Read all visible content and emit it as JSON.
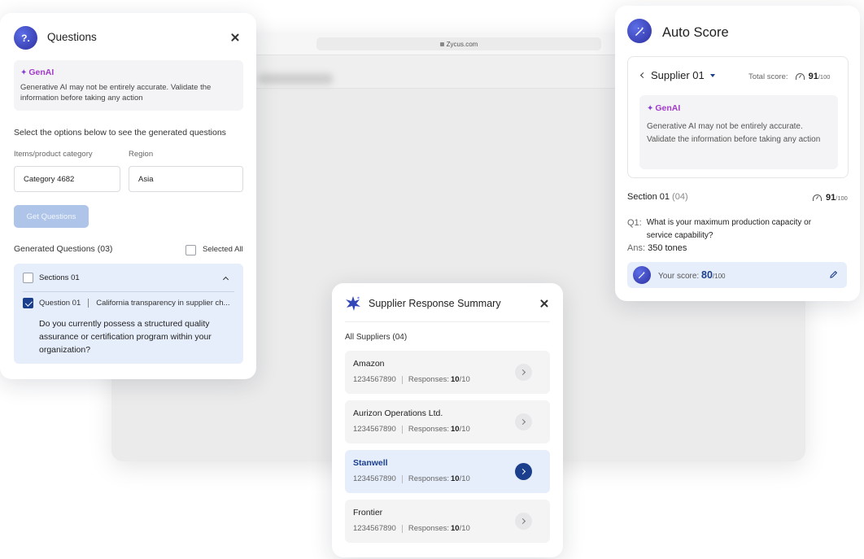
{
  "browser": {
    "url": "Zycus.com"
  },
  "questions_panel": {
    "badge": "?.",
    "title": "Questions",
    "genai": {
      "label": "GenAI",
      "disclaimer": "Generative AI may not be entirely accurate. Validate the information before taking any action"
    },
    "select_hint": "Select the options below to see the generated questions",
    "category_label": "Items/product category",
    "category_value": "Category 4682",
    "region_label": "Region",
    "region_value": "Asia",
    "get_button": "Get Questions",
    "generated_title": "Generated Questions (03)",
    "select_all": "Selected All",
    "section": {
      "title": "Sections 01",
      "question_number": "Question 01",
      "question_topic": "California transparency in supplier ch...",
      "question_text": "Do you currently possess a structured quality assurance or certification program within your organization?"
    }
  },
  "summary_panel": {
    "title": "Supplier Response Summary",
    "all_suppliers": "All Suppliers (04)",
    "responses_label": "Responses:",
    "suppliers": [
      {
        "name": "Amazon",
        "id": "1234567890",
        "answered": "10",
        "total": "/10",
        "active": false
      },
      {
        "name": "Aurizon Operations Ltd.",
        "id": "1234567890",
        "answered": "10",
        "total": "/10",
        "active": false
      },
      {
        "name": "Stanwell",
        "id": "1234567890",
        "answered": "10",
        "total": "/10",
        "active": true
      },
      {
        "name": "Frontier",
        "id": "1234567890",
        "answered": "10",
        "total": "/10",
        "active": false
      }
    ]
  },
  "autoscore_panel": {
    "title": "Auto Score",
    "supplier": "Supplier 01",
    "total_label": "Total score:",
    "total_score": "91",
    "total_max": "/100",
    "genai": {
      "label": "GenAI",
      "disclaimer": "Generative AI may not be entirely accurate. Validate the information before taking any action"
    },
    "section_label": "Section 01",
    "section_count": "(04)",
    "section_score": "91",
    "section_max": "/100",
    "question_label": "Q1:",
    "question_text": "What is your maximum production capacity or service capability?",
    "answer_label": "Ans:",
    "answer_value": "350 tones",
    "your_score_label": "Your score:",
    "your_score": "80",
    "your_score_max": "/100"
  },
  "colors": {
    "accent": "#1b3f8c",
    "highlight": "#e6eefb",
    "genai": "#a33bc9"
  }
}
